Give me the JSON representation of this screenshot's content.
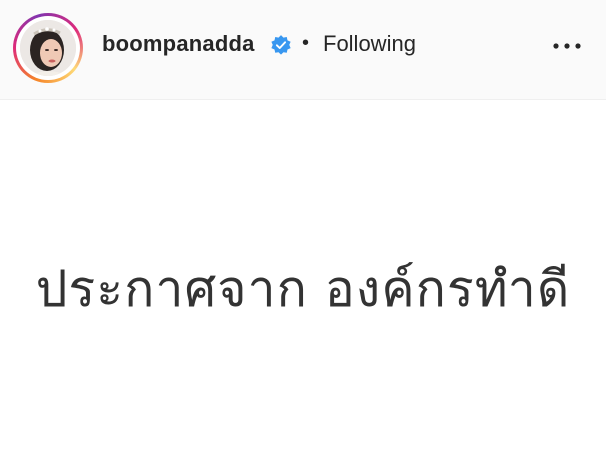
{
  "header": {
    "username": "boompanadda",
    "separator": "•",
    "follow_label": "Following",
    "verified_icon": "verified-badge-icon",
    "more_icon": "more-options-icon"
  },
  "post": {
    "text": "ประกาศจาก องค์กรทำดี"
  },
  "colors": {
    "header_bg": "#fafafa",
    "verified": "#3897f0",
    "text": "#262626",
    "post_text": "#333333"
  }
}
